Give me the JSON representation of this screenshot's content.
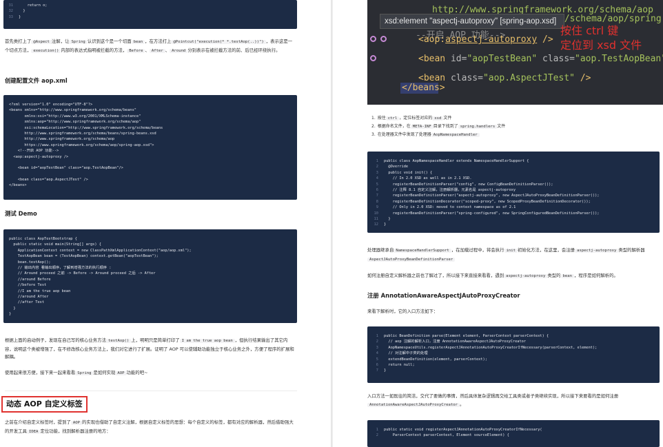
{
  "left": {
    "top_code": [
      {
        "n": "31",
        "t": "    return o;"
      },
      {
        "n": "32",
        "t": "  }"
      },
      {
        "n": "33",
        "t": "}"
      }
    ],
    "intro_para": {
      "p1": "首先类打上了",
      "c1": "@Aspect",
      "p2": "注解，让",
      "c2": "Spring",
      "p3": "认识到这个是一个切面",
      "c3": "bean",
      "p4": "，在方法打上",
      "c4": "@Pointcut(\"execution(* *.testAop(..))\")",
      "p5": "，表示这是一个切点方法，",
      "c5": "execution()",
      "p6": "内部的表达式指明被拦截的方法，",
      "c6": "Before",
      "p7": "、",
      "c7": "After",
      "p8": "、",
      "c8": "Around",
      "p9": "分别表示在被拦截方法的前、后已经环绕执行。"
    },
    "h_config": "创建配置文件 aop.xml",
    "xml_code": [
      "<?xml version=\"1.0\" encoding=\"UTF-8\"?>",
      "<beans xmlns=\"http://www.springframework.org/schema/beans\"",
      "       xmlns:xsi=\"http://www.w3.org/2001/XMLSchema-instance\"",
      "       xmlns:aop=\"http://www.springframework.org/schema/aop\"",
      "       xsi:schemaLocation=\"http://www.springframework.org/schema/beans",
      "       http://www.springframework.org/schema/beans/spring-beans.xsd",
      "       http://www.springframework.org/schema/aop",
      "       https://www.springframework.org/schema/aop/spring-aop.xsd\">",
      "    <!--开启 AOP 功能-->",
      "  <aop:aspectj-autoproxy />",
      "",
      "    <bean id=\"aopTestBean\" class=\"aop.TestAopBean\"/>",
      "",
      "    <bean class=\"aop.AspectJTest\" />",
      "</beans>"
    ],
    "h_demo": "测试 Demo",
    "java_code": [
      "public class AopTestBootstrap {",
      "  public static void main(String[] args) {",
      "    ApplicationContext context = new ClassPathXmlApplicationContext(\"aop/aop.xml\");",
      "    TestAopBean bean = (TestAopBean) context.getBean(\"aopTestBean\");",
      "    bean.testAop();",
      "    // 输出内容 看输出顺序，了解到增强方法的执行顺序 :",
      "    // Around proceed 之前 -> Before -> Around proceed 之后 -> After",
      "    //around Before",
      "    //before Test",
      "    //I am the true aop bean",
      "    //around After",
      "    //after Test",
      "  }",
      "}"
    ],
    "result_para": {
      "p1": "根据上面的启动例子，发现在自己写的核心业务方法",
      "c1": "testAop()",
      "p2": "上，明明只是简单打印了",
      "c2": "I am the true aop bean",
      "p3": "，但执行结果输出了其它内容，说明这个类被增强了，在不修改核心业务方法上，我们对它进行了扩展。证明了 AOP 可以使辅助功能独立于核心业务之外，方便了程序的扩展和解耦。"
    },
    "easy_para": {
      "p1": "使用起来很方便，接下来一起来看看",
      "c1": "Spring",
      "p2": "是如何实现",
      "c2": "AOP",
      "p3": "功能的吧~"
    },
    "h_dynamic": "动态 AOP 自定义标签",
    "dyn_para": {
      "p1": "之前在介绍自定义标签时，提到了",
      "c1": "AOP",
      "p2": "的实现也借助了自定义注解，根据自定义标签的思想：每个自定义的标签，都有对应的解析器，然后借助强大的开发工具",
      "c2": "IDEA",
      "p3": "定位功能，找到解析器注册的地方："
    }
  },
  "right": {
    "ide": {
      "line_url1": "http://www.springframework.org/schema/aop",
      "line_url2": "g/schema/aop/spring-",
      "line_comment": "--开启 AOP 功能-->",
      "line_aop_pre": "<aop:",
      "line_aop_tag": "aspectj-autoproxy",
      "line_aop_post": " />",
      "line_bean1_a": "<bean ",
      "line_bean1_b": "id=",
      "line_bean1_c": "\"aopTestBean\"",
      "line_bean1_d": " class=",
      "line_bean1_e": "\"aop.TestAopBean\"",
      "line_bean1_f": "/>",
      "line_bean2_a": "<bean ",
      "line_bean2_b": "class=",
      "line_bean2_c": "\"aop.AspectJTest\"",
      "line_bean2_d": " />",
      "line_close": "</beans>",
      "tooltip": "xsd:element \"aspectj-autoproxy\" [spring-aop.xsd]",
      "annot1": "按住 ctrl 键",
      "annot2": "定位到 xsd 文件"
    },
    "steps": [
      {
        "n": "1.",
        "p1": "按住",
        "c1": "ctrl",
        "p2": "，定位标签对应的",
        "c2": "xsd",
        "p3": "文件"
      },
      {
        "n": "2.",
        "p1": "根据命名文件，在",
        "c1": "META-INF",
        "p2": "目录下找到了",
        "c2": "spring.handlers",
        "p3": "文件"
      },
      {
        "n": "3.",
        "p1": "在处理器文件中发现了处理器",
        "c1": "AopNamespaceHandler",
        "p2": "",
        "c2": "",
        "p3": ""
      }
    ],
    "handler_code": [
      {
        "n": "1",
        "t": "public class AopNamespaceHandler extends NamespaceHandlerSupport {"
      },
      {
        "n": "2",
        "t": "  @Override"
      },
      {
        "n": "3",
        "t": "  public void init() {"
      },
      {
        "n": "4",
        "t": "    // In 2.0 XSD as well as in 2.1 XSD."
      },
      {
        "n": "5",
        "t": "    registerBeanDefinitionParser(\"config\", new ConfigBeanDefinitionParser());"
      },
      {
        "n": "6",
        "t": "    // 注释 8.1 自定义注解，注册解析器，元素名是 aspectj-autoproxy"
      },
      {
        "n": "7",
        "t": "    registerBeanDefinitionParser(\"aspectj-autoproxy\", new AspectJAutoProxyBeanDefinitionParser());"
      },
      {
        "n": "8",
        "t": "    registerBeanDefinitionDecorator(\"scoped-proxy\", new ScopedProxyBeanDefinitionDecorator());"
      },
      {
        "n": "9",
        "t": "    // Only in 2.0 XSD: moved to context namespace as of 2.1"
      },
      {
        "n": "10",
        "t": "    registerBeanDefinitionParser(\"spring-configured\", new SpringConfiguredBeanDefinitionParser());"
      },
      {
        "n": "11",
        "t": "  }"
      },
      {
        "n": "12",
        "t": "}"
      }
    ],
    "handler_para": {
      "p1": "处理器继承自",
      "c1": "NamespaceHandlerSupport",
      "p2": "，在加载过程中，将会执行",
      "c2": "init",
      "p3": "初始化方法，在这里，会注册",
      "c3": "aspectj-autoproxy",
      "p4": "类型的解析器",
      "c4": "AspectJAutoProxyBeanDefinitionParser"
    },
    "register_para": {
      "p1": "如何注册自定义解析器之前也了解过了，所以接下来直接来看看，遇到",
      "c1": "aspectj-autoproxy",
      "p2": "类型的",
      "c2": "bean",
      "p3": "，程序是如何解析的。"
    },
    "h_register": "注册 AnnotationAwareAspectJAutoProxyCreator",
    "parse_intro": "来看下解析时，它的入口方法如下：",
    "parse_code": [
      {
        "n": "1",
        "t": "public BeanDefinition parse(Element element, ParserContext parserContext) {"
      },
      {
        "n": "2",
        "t": "  // aop 注解的解析入口，注册 AnnotationAwareAspectJAutoProxyCreator"
      },
      {
        "n": "3",
        "t": "  AopNamespaceUtils.registerAspectJAnnotationAutoProxyCreatorIfNecessary(parserContext, element);"
      },
      {
        "n": "4",
        "t": "  // 对注解中子类的处理"
      },
      {
        "n": "5",
        "t": "  extendBeanDefinition(element, parserContext);"
      },
      {
        "n": "6",
        "t": "  return null;"
      },
      {
        "n": "7",
        "t": "}"
      }
    ],
    "entry_para": {
      "p1": "入口方法一如既往的简洁，交代了要做的事情，然后具体复杂逻辑再交给工具类或者子类继续实现，所以接下来要看的是如何注册",
      "c1": "AnnotationAwareAspectJAutoProxyCreator",
      "p2": "。"
    },
    "last_code": [
      {
        "n": "1",
        "t": "public static void registerAspectJAnnotationAutoProxyCreatorIfNecessary("
      },
      {
        "n": "2",
        "t": "    ParserContext parserContext, Element sourceElement) {"
      }
    ]
  }
}
